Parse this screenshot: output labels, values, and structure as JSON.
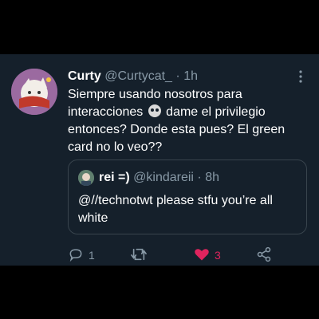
{
  "tweet": {
    "author_name": "Curty",
    "author_handle": "@Curtycat_",
    "separator": "·",
    "time": "1h",
    "text_before_emoji": "Siempre usando nosotros para interacciones ",
    "emoji": "skull-emoji",
    "text_after_emoji": " dame el privilegio entonces? Donde esta pues? El green card no lo veo??"
  },
  "quoted_tweet": {
    "author_name": "rei =)",
    "author_handle": "@kindareii",
    "separator": "·",
    "time": "8h",
    "text": "@//technotwt please stfu you’re all white"
  },
  "actions": {
    "reply_count": "1",
    "retweet_count": "",
    "like_count": "3"
  },
  "colors": {
    "background": "#15202b",
    "secondary_text": "#8899a6",
    "like_active": "#e0245e",
    "border": "#38444d"
  },
  "icons": [
    "more-icon",
    "reply-icon",
    "retweet-icon",
    "like-icon",
    "share-icon"
  ]
}
